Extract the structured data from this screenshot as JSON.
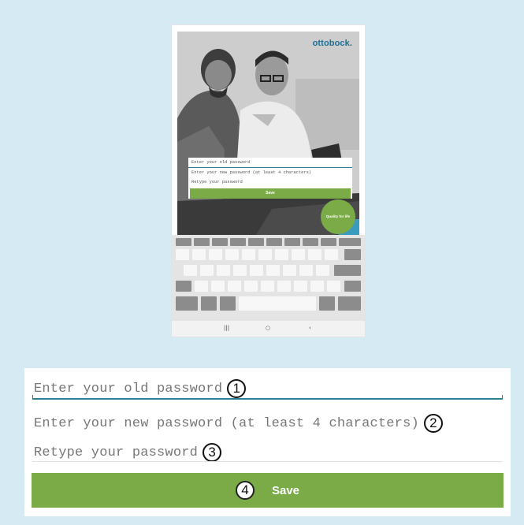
{
  "tablet": {
    "brand": "ottobock.",
    "form": {
      "old_password_placeholder": "Enter your old password",
      "new_password_placeholder": "Enter your new password (at least 4 characters)",
      "retype_password_placeholder": "Retype your password",
      "save_label": "Save"
    },
    "badge_text": "Quality for life",
    "navbar": {
      "recent_icon": "|||",
      "home_icon": "○",
      "back_icon": "‹"
    }
  },
  "form": {
    "old_password": {
      "placeholder": "Enter your old password",
      "marker": "1"
    },
    "new_password": {
      "placeholder": "Enter your new password (at least 4 characters)",
      "marker": "2"
    },
    "retype_password": {
      "placeholder": "Retype your password",
      "marker": "3"
    },
    "save": {
      "label": "Save",
      "marker": "4"
    }
  },
  "colors": {
    "background": "#d6eaf4",
    "accent_green": "#7aab47",
    "underline_teal": "#2e7f91",
    "brand_blue": "#1f6f95"
  }
}
